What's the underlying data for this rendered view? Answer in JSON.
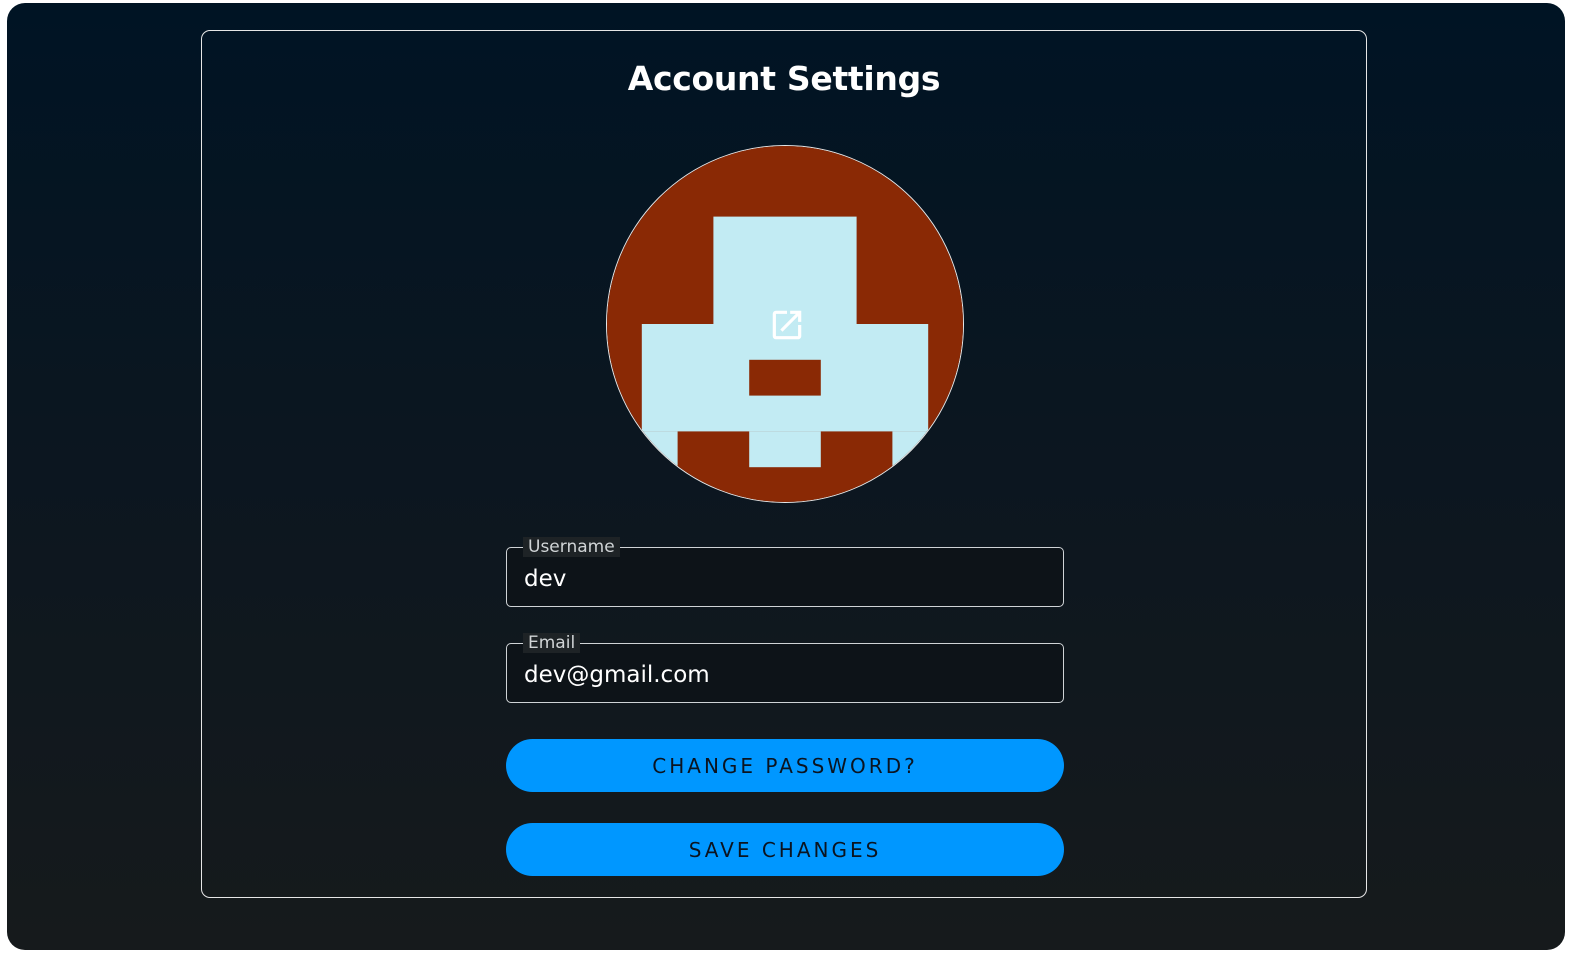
{
  "page": {
    "title": "Account Settings"
  },
  "avatar": {
    "icon": "open-in-new-icon",
    "identicon_colors": {
      "background": "#8a2905",
      "foreground": "#c2ebf3"
    }
  },
  "form": {
    "username": {
      "label": "Username",
      "value": "dev"
    },
    "email": {
      "label": "Email",
      "value": "dev@gmail.com"
    }
  },
  "buttons": {
    "change_password": "CHANGE PASSWORD?",
    "save_changes": "SAVE CHANGES"
  },
  "colors": {
    "accent": "#0097ff",
    "border": "#e6e6e6"
  }
}
